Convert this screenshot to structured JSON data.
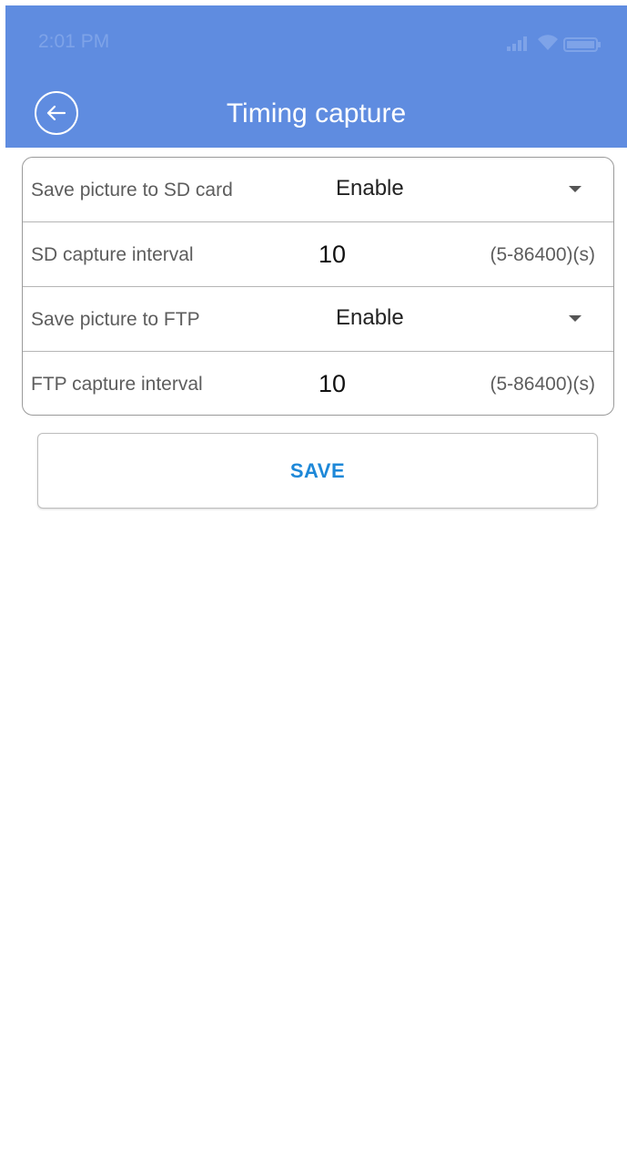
{
  "status_bar": {
    "time": "2:01 PM",
    "icons": [
      "signal-icon",
      "wifi-icon",
      "battery-icon"
    ]
  },
  "header": {
    "title": "Timing capture",
    "back_icon": "back-arrow-icon",
    "background_color": "#5f8ce0"
  },
  "settings": {
    "sd_save": {
      "label": "Save picture to SD card",
      "value": "Enable"
    },
    "sd_interval": {
      "label": "SD capture interval",
      "value": "10",
      "hint": "(5-86400)(s)"
    },
    "ftp_save": {
      "label": "Save picture to FTP",
      "value": "Enable"
    },
    "ftp_interval": {
      "label": "FTP capture interval",
      "value": "10",
      "hint": "(5-86400)(s)"
    }
  },
  "actions": {
    "save_label": "SAVE",
    "save_color": "#1e88d8"
  }
}
